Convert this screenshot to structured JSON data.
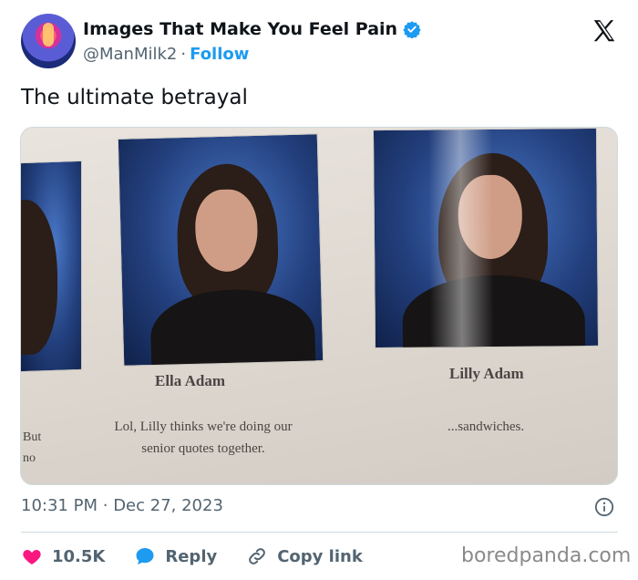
{
  "author": {
    "display_name": "Images That Make You Feel Pain",
    "handle": "@ManMilk2",
    "separator": "·",
    "follow_label": "Follow",
    "verified": true
  },
  "tweet": {
    "text": "The ultimate betrayal",
    "time": "10:31 PM",
    "date_separator": "·",
    "date": "Dec 27, 2023"
  },
  "yearbook": {
    "left_partial_quote_line1": "But",
    "left_partial_quote_line2": "no",
    "student1_name": "Ella Adam",
    "student1_quote_line1": "Lol, Lilly thinks we're doing our",
    "student1_quote_line2": "senior quotes together.",
    "student2_name": "Lilly Adam",
    "student2_quote": "...sandwiches."
  },
  "actions": {
    "likes_count": "10.5K",
    "reply_label": "Reply",
    "copy_link_label": "Copy link"
  },
  "watermark": "boredpanda.com",
  "colors": {
    "accent": "#1d9bf0",
    "like": "#f91880",
    "secondary_text": "#536471",
    "divider": "#cfd9de"
  },
  "icons": {
    "verified": "verified-badge-icon",
    "platform": "x-logo-icon",
    "info": "info-icon",
    "like": "heart-icon",
    "reply": "speech-bubble-icon",
    "copy": "link-icon"
  }
}
